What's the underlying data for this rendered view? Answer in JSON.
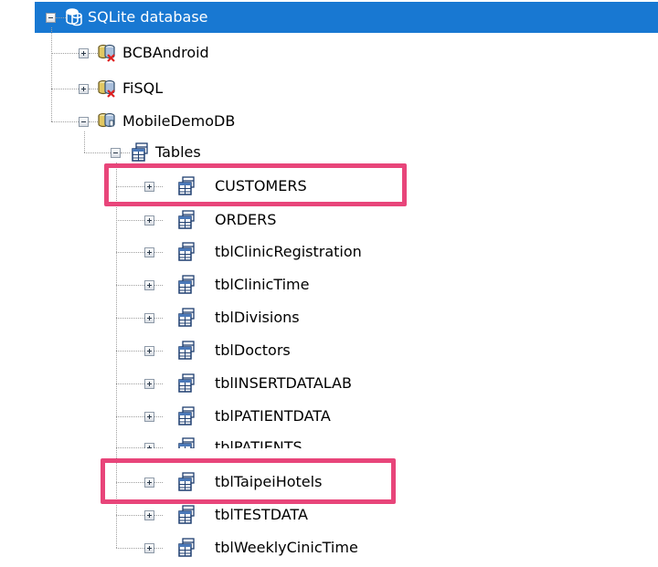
{
  "tree": {
    "root": {
      "label": "SQLite database",
      "icon": "database-server-icon",
      "expanded": true,
      "selected": true
    },
    "databases": [
      {
        "label": "BCBAndroid",
        "icon": "database-disconnected-icon",
        "expanded": false
      },
      {
        "label": "FiSQL",
        "icon": "database-disconnected-icon",
        "expanded": false
      },
      {
        "label": "MobileDemoDB",
        "icon": "database-connected-icon",
        "expanded": true
      }
    ],
    "tables_folder": {
      "label": "Tables",
      "icon": "tables-folder-icon",
      "expanded": true
    },
    "tables": [
      {
        "label": "CUSTOMERS",
        "icon": "table-icon",
        "highlighted": true
      },
      {
        "label": "ORDERS",
        "icon": "table-icon"
      },
      {
        "label": "tblClinicRegistration",
        "icon": "table-icon"
      },
      {
        "label": "tblClinicTime",
        "icon": "table-icon"
      },
      {
        "label": "tblDivisions",
        "icon": "table-icon"
      },
      {
        "label": "tblDoctors",
        "icon": "table-icon"
      },
      {
        "label": "tblINSERTDATALAB",
        "icon": "table-icon"
      },
      {
        "label": "tblPATIENTDATA",
        "icon": "table-icon"
      },
      {
        "label": "tblPATIENTS",
        "icon": "table-icon",
        "partially_obscured": true
      },
      {
        "label": "tblTaipeiHotels",
        "icon": "table-icon",
        "highlighted": true
      },
      {
        "label": "tblTESTDATA",
        "icon": "table-icon"
      },
      {
        "label": "tblWeeklyCinicTime",
        "icon": "table-icon"
      }
    ]
  },
  "colors": {
    "selection": "#1878d2",
    "highlight_box": "#e8457a",
    "tree_lines": "#a0a0a0"
  }
}
